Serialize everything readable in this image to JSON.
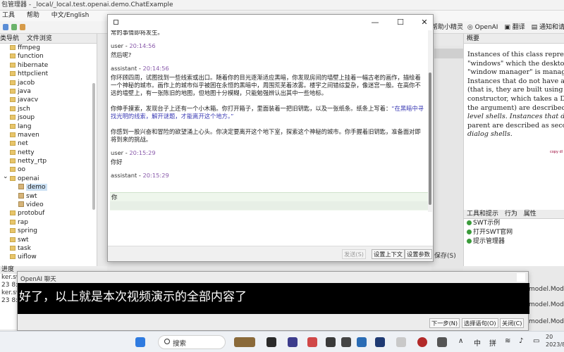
{
  "ide": {
    "title": "包管理器 - _local/_local.test.openai.demo.ChatExample",
    "menu": [
      "工具",
      "帮助",
      "中文/English"
    ],
    "toolbar_right": [
      "帮助小精灵",
      "OpenAI",
      "翻译",
      "通知和请求"
    ],
    "left_tabs": [
      "类导航",
      "文件浏览"
    ],
    "tree": [
      {
        "label": "ffmpeg",
        "indent": 1
      },
      {
        "label": "function",
        "indent": 1
      },
      {
        "label": "hibernate",
        "indent": 1
      },
      {
        "label": "httpclient",
        "indent": 1
      },
      {
        "label": "jacob",
        "indent": 1
      },
      {
        "label": "java",
        "indent": 1
      },
      {
        "label": "javacv",
        "indent": 1
      },
      {
        "label": "jsch",
        "indent": 1
      },
      {
        "label": "jsoup",
        "indent": 1
      },
      {
        "label": "lang",
        "indent": 1
      },
      {
        "label": "maven",
        "indent": 1
      },
      {
        "label": "net",
        "indent": 1
      },
      {
        "label": "netty",
        "indent": 1
      },
      {
        "label": "netty_rtp",
        "indent": 1
      },
      {
        "label": "oo",
        "indent": 1
      },
      {
        "label": "openai",
        "indent": 1,
        "expanded": true
      },
      {
        "label": "demo",
        "indent": 2,
        "selected": true
      },
      {
        "label": "swt",
        "indent": 2
      },
      {
        "label": "video",
        "indent": 2
      },
      {
        "label": "protobuf",
        "indent": 1
      },
      {
        "label": "rap",
        "indent": 1
      },
      {
        "label": "spring",
        "indent": 1
      },
      {
        "label": "swt",
        "indent": 1
      },
      {
        "label": "task",
        "indent": 1
      },
      {
        "label": "uiflow",
        "indent": 1
      }
    ],
    "left_bottom_tab": "进度",
    "left_bottom_rows": [
      "ker.sw",
      "23 8:1",
      "ker.sw",
      "23 8:1"
    ],
    "right_tab": "概要",
    "right_doc_lines": [
      "Instances of this class represen",
      "\"windows\" which the desktop",
      "\"window manager\" is managin",
      "Instances that do not have a pa",
      "(that is, they are built using the",
      "constructor, which takes a Disp",
      "the argument) are described as",
      "level shells. Instances that do l",
      "parent are described as second",
      "dialog shells."
    ],
    "right_copy": "copy dl",
    "right_bottom_tabs": [
      "工具和提示",
      "行为",
      "属性"
    ],
    "right_bottom_items": [
      "SWT示例",
      "打开SWT官网",
      "提示管理器"
    ],
    "save_label": "保存(S)",
    "model_labels": [
      "model.Mode",
      "model.Mode",
      "model.Mode"
    ]
  },
  "chat_window": {
    "messages": [
      {
        "role": "",
        "time": "",
        "body": [
          "常的事情即将发生。"
        ]
      },
      {
        "role": "user",
        "time": "20:14:56",
        "body": [
          "然后呢?"
        ]
      },
      {
        "role": "assistant",
        "time": "20:14:56",
        "body": [
          "你环顾四周，试图找到一些线索或出口。随着你的目光逐渐适应黑暗，你发现房间的墙壁上挂着一幅古老的画作，描绘着一个神秘的城市。画作上的城市似乎被困在永恒的黑暗中，周围荒芜着浓雾。楼宇之间错综复杂，像迷宫一般。在高你不远的墙壁上，有一张陈旧的地图，但地图十分模糊，只能勉强辨认出其中一些地标。",
          "你伸手摸索，发现台子上还有一个小木箱。你打开箱子，里面装着一把旧钥匙，以及一张纸条。纸条上写着：",
          "“在黑暗中寻找光明的线索，解开谜题，才能离开这个地方。”",
          "你感到一股兴奋和冒险的欲望涌上心头。你决定要离开这个地下室，探索这个神秘的城市。你手握着旧钥匙，准备面对即将到来的挑战。"
        ]
      },
      {
        "role": "user",
        "time": "20:15:29",
        "body": [
          "你好"
        ]
      },
      {
        "role": "assistant",
        "time": "20:15:29",
        "body": [
          "你"
        ]
      }
    ],
    "input_value": "",
    "buttons": {
      "send": "发送(S)",
      "context": "设置上下文",
      "params": "设置参数"
    }
  },
  "subtitle_window": {
    "title": "OpenAI 聊天",
    "text": "好了，以上就是本次视频演示的全部内容了",
    "buttons": {
      "next": "下一步(N)",
      "select": "选择语句(O)",
      "close": "关闭(C)"
    }
  },
  "taskbar": {
    "search_placeholder": "搜索",
    "lang": "中",
    "input_mode": "拼",
    "clock_year": "20",
    "clock_date": "2023/8"
  }
}
